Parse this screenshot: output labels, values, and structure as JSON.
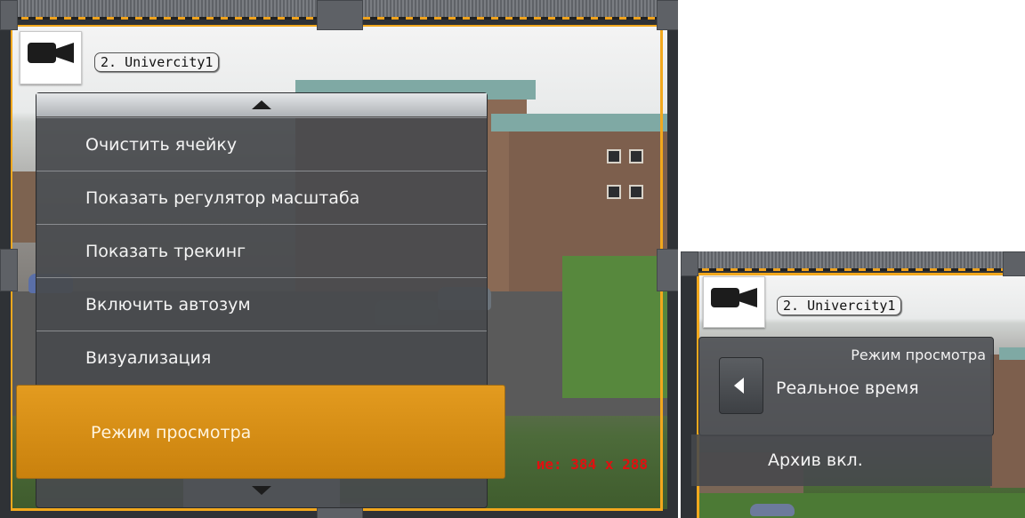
{
  "left_panel": {
    "camera_label": "2. Univercity1",
    "menu_items": [
      "Очистить ячейку",
      "Показать регулятор масштаба",
      "Показать трекинг",
      "Включить автозум",
      "Визуализация"
    ],
    "selected_item": "Режим просмотра",
    "resolution_text": "ие: 384 x 288"
  },
  "right_panel": {
    "camera_label": "2. Univercity1",
    "submenu_title": "Режим просмотра",
    "submenu_value": "Реальное время",
    "archive_item": "Архив вкл."
  },
  "colors": {
    "accent_orange": "#f2a81d",
    "selected_bg": "#d98f15",
    "resolution_red": "#e01010"
  },
  "icons": [
    "camera-icon",
    "menu-up-arrow-icon",
    "menu-down-arrow-icon",
    "left-arrow-icon"
  ]
}
